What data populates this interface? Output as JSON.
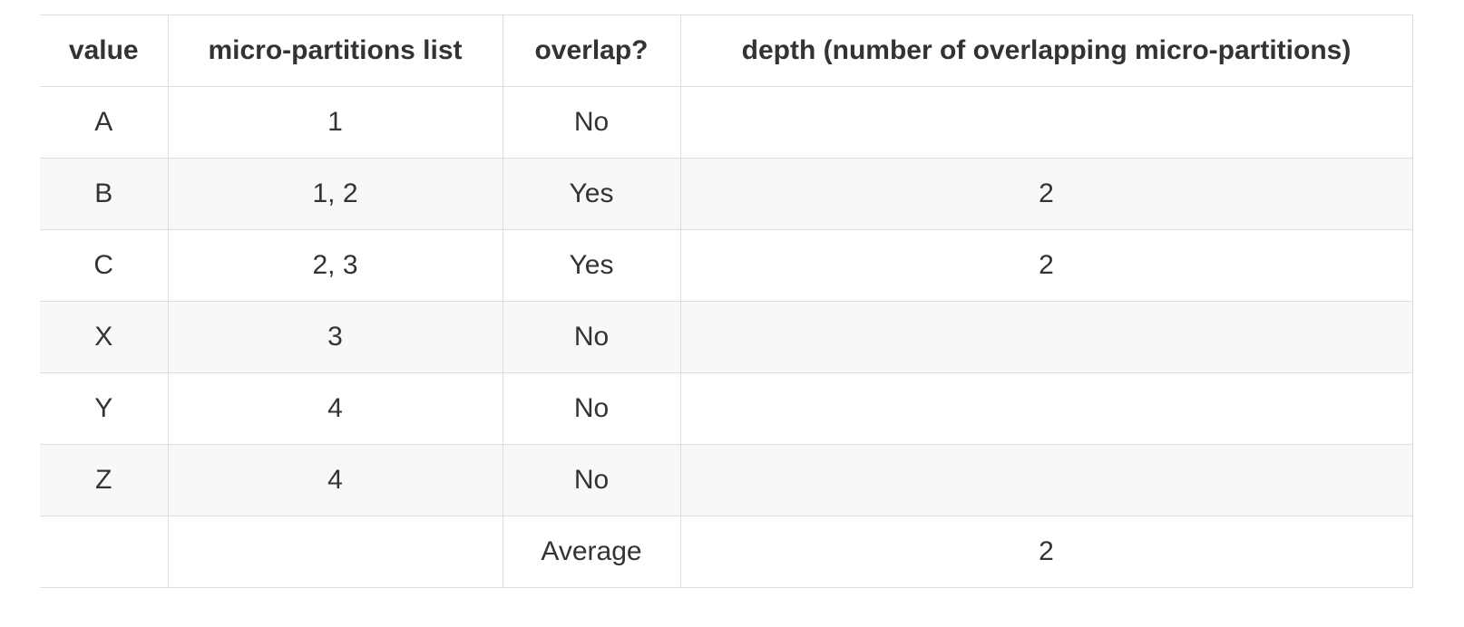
{
  "table": {
    "headers": [
      "value",
      "micro-partitions list",
      "overlap?",
      "depth (number of overlapping micro-partitions)"
    ],
    "rows": [
      [
        "A",
        "1",
        "No",
        ""
      ],
      [
        "B",
        "1, 2",
        "Yes",
        "2"
      ],
      [
        "C",
        "2, 3",
        "Yes",
        "2"
      ],
      [
        "X",
        "3",
        "No",
        ""
      ],
      [
        "Y",
        "4",
        "No",
        ""
      ],
      [
        "Z",
        "4",
        "No",
        ""
      ],
      [
        "",
        "",
        "Average",
        "2"
      ]
    ]
  }
}
